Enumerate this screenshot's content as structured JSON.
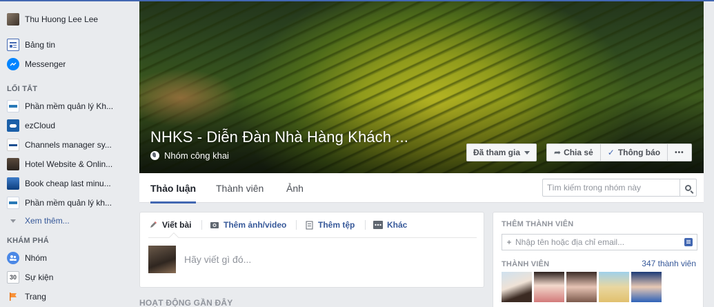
{
  "sidebar": {
    "user": {
      "name": "Thu Huong Lee Lee"
    },
    "main_items": [
      {
        "label": "Bảng tin",
        "icon": "news-feed-icon"
      },
      {
        "label": "Messenger",
        "icon": "messenger-icon"
      }
    ],
    "shortcuts_heading": "LỐI TẮT",
    "shortcuts": [
      {
        "label": "Phần mềm quản lý Kh..."
      },
      {
        "label": "ezCloud"
      },
      {
        "label": "Channels manager sy..."
      },
      {
        "label": "Hotel Website & Onlin..."
      },
      {
        "label": "Book cheap last minu..."
      },
      {
        "label": "Phần mềm quản lý kh..."
      }
    ],
    "see_more": "Xem thêm...",
    "explore_heading": "KHÁM PHÁ",
    "explore": [
      {
        "label": "Nhóm",
        "icon": "groups-icon"
      },
      {
        "label": "Sự kiện",
        "icon": "events-icon",
        "badge": "30"
      },
      {
        "label": "Trang",
        "icon": "pages-flag-icon"
      }
    ]
  },
  "group": {
    "name": "NHKS - Diễn Đàn Nhà Hàng Khách ...",
    "privacy": "Nhóm công khai",
    "joined_button": "Đã tham gia",
    "share_button": "Chia sẻ",
    "notify_button": "Thông báo",
    "more_button": "•••"
  },
  "tabs": [
    {
      "label": "Thảo luận",
      "active": true
    },
    {
      "label": "Thành viên",
      "active": false
    },
    {
      "label": "Ảnh",
      "active": false
    }
  ],
  "search": {
    "placeholder": "Tìm kiếm trong nhóm này"
  },
  "composer": {
    "tabs": [
      {
        "label": "Viết bài",
        "icon": "pencil-icon"
      },
      {
        "label": "Thêm ảnh/video",
        "icon": "camera-icon"
      },
      {
        "label": "Thêm tệp",
        "icon": "file-icon"
      },
      {
        "label": "Khác",
        "icon": "more-icon"
      }
    ],
    "placeholder": "Hãy viết gì đó..."
  },
  "recent_activity_heading": "HOẠT ĐỘNG GẦN ĐÂY",
  "right_panel": {
    "add_members_heading": "THÊM THÀNH VIÊN",
    "add_members_placeholder": "Nhập tên hoặc địa chỉ email...",
    "members_heading": "THÀNH VIÊN",
    "members_count": "347 thành viên"
  },
  "colors": {
    "accent": "#4267b2",
    "link": "#365899",
    "background": "#e9ebee"
  }
}
